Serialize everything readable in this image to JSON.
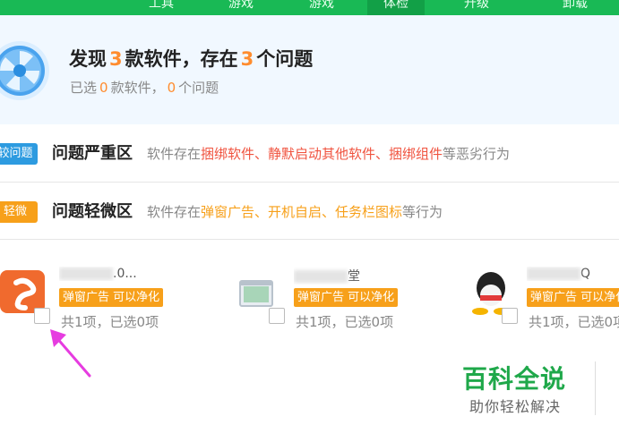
{
  "colors": {
    "brand_green": "#19b955",
    "accent_orange": "#ff8c2e",
    "severe_red": "#f0533f",
    "minor_orange": "#f7a01a",
    "tag_blue": "#2d9be0"
  },
  "nav": {
    "items": [
      "工具",
      "游戏",
      "游戏",
      "体检",
      "升级",
      "卸载"
    ]
  },
  "summary": {
    "title_prefix": "发现",
    "found_count": "3",
    "title_middle": "款软件，存在",
    "problem_count": "3",
    "title_suffix": "个问题",
    "sub_prefix": "已选",
    "selected_apps": "0",
    "sub_middle": "款软件，",
    "selected_problems": "0",
    "sub_suffix": "个问题"
  },
  "zones": {
    "severe": {
      "tag": "较问题",
      "title": "问题严重区",
      "desc_prefix": "软件存在",
      "desc_highlight": "捆绑软件、静默启动其他软件、捆绑组件",
      "desc_suffix": "等恶劣行为"
    },
    "minor": {
      "tag": "轻微",
      "title": "问题轻微区",
      "desc_prefix": "软件存在",
      "desc_highlight": "弹窗广告、开机自启、任务栏图标",
      "desc_suffix": "等行为"
    }
  },
  "apps": [
    {
      "name_tail": ".0...",
      "badge": "弹窗广告 可以净化",
      "count": "共1项，已选0项",
      "icon": "sogou-input-icon"
    },
    {
      "name_tail": "堂",
      "badge": "弹窗广告 可以净化",
      "count": "共1项，已选0项",
      "icon": "window-app-icon"
    },
    {
      "name_tail": "Q",
      "badge": "弹窗广告 可以净化",
      "count": "共1项，已选0项",
      "icon": "qq-penguin-icon"
    }
  ],
  "watermark": {
    "title": "百科全说",
    "subtitle": "助你轻松解决"
  }
}
